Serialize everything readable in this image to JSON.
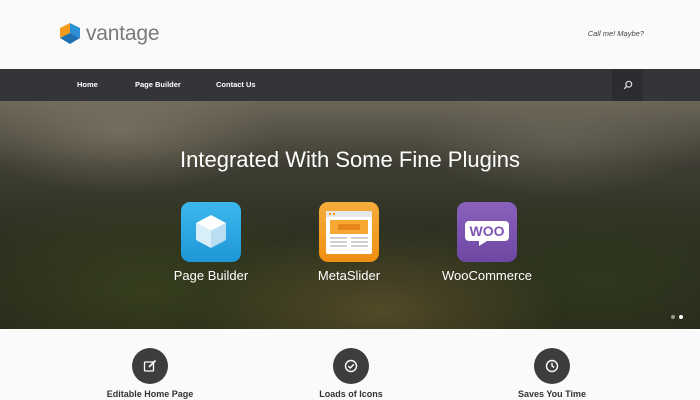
{
  "header": {
    "logo_text": "vantage",
    "tagline": "Call me! Maybe?"
  },
  "nav": {
    "items": [
      {
        "label": "Home"
      },
      {
        "label": "Page Builder"
      },
      {
        "label": "Contact Us"
      }
    ],
    "search_icon": "search-icon"
  },
  "hero": {
    "title": "Integrated With Some Fine Plugins",
    "plugins": [
      {
        "label": "Page Builder",
        "icon": "cube-icon",
        "color": "#29a9e0"
      },
      {
        "label": "MetaSlider",
        "icon": "slider-icon",
        "color": "#f29a1a"
      },
      {
        "label": "WooCommerce",
        "icon": "woo-icon",
        "color": "#7f54b3"
      }
    ],
    "slide_dots": 2,
    "active_slide": 2
  },
  "features": [
    {
      "title": "Editable Home Page",
      "icon": "edit-icon"
    },
    {
      "title": "Loads of Icons",
      "icon": "check-icon"
    },
    {
      "title": "Saves You Time",
      "icon": "clock-icon"
    }
  ],
  "colors": {
    "nav_bg": "#343538",
    "brand_blue": "#2b8fd6",
    "brand_orange": "#f29a1a",
    "feature_icon_bg": "#3d3d3d"
  }
}
